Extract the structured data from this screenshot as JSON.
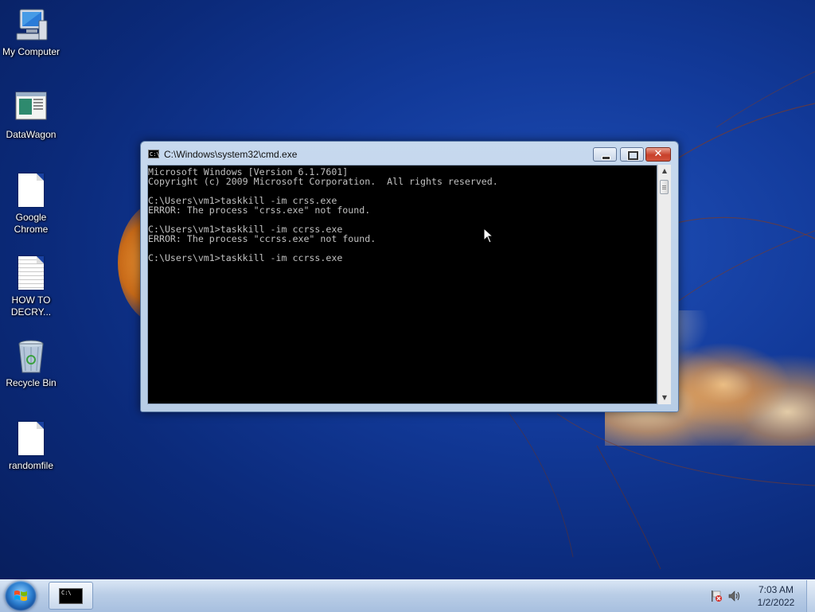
{
  "desktop": {
    "icons": [
      {
        "label": "My Computer",
        "icon": "computer-icon"
      },
      {
        "label": "DataWagon",
        "icon": "app-window-icon"
      },
      {
        "label": "Google Chrome",
        "icon": "blank-document-icon"
      },
      {
        "label": "HOW TO DECRY...",
        "icon": "text-document-icon"
      },
      {
        "label": "Recycle Bin",
        "icon": "recycle-bin-icon"
      },
      {
        "label": "randomfile",
        "icon": "blank-document-icon"
      }
    ]
  },
  "cmd_window": {
    "title": "C:\\Windows\\system32\\cmd.exe",
    "icon_text": "C:\\",
    "lines": [
      "Microsoft Windows [Version 6.1.7601]",
      "Copyright (c) 2009 Microsoft Corporation.  All rights reserved.",
      "",
      "C:\\Users\\vm1>taskkill -im crss.exe",
      "ERROR: The process \"crss.exe\" not found.",
      "",
      "C:\\Users\\vm1>taskkill -im ccrss.exe",
      "ERROR: The process \"ccrss.exe\" not found.",
      "",
      "C:\\Users\\vm1>taskkill -im ccrss.exe"
    ],
    "buttons": {
      "minimize": "minimize-icon",
      "maximize": "maximize-icon",
      "close": "close-icon"
    }
  },
  "taskbar": {
    "start": "windows-logo-icon",
    "running_app": {
      "icon": "cmd-icon",
      "icon_text": "C:\\"
    },
    "tray": {
      "icons": [
        "action-center-flag-icon",
        "volume-icon"
      ],
      "time": "7:03 AM",
      "date": "1/2/2022"
    }
  },
  "colors": {
    "desktop_bg": "#123a9a",
    "console_bg": "#000000",
    "console_text": "#c0c0c0",
    "close_button": "#c8402a"
  }
}
